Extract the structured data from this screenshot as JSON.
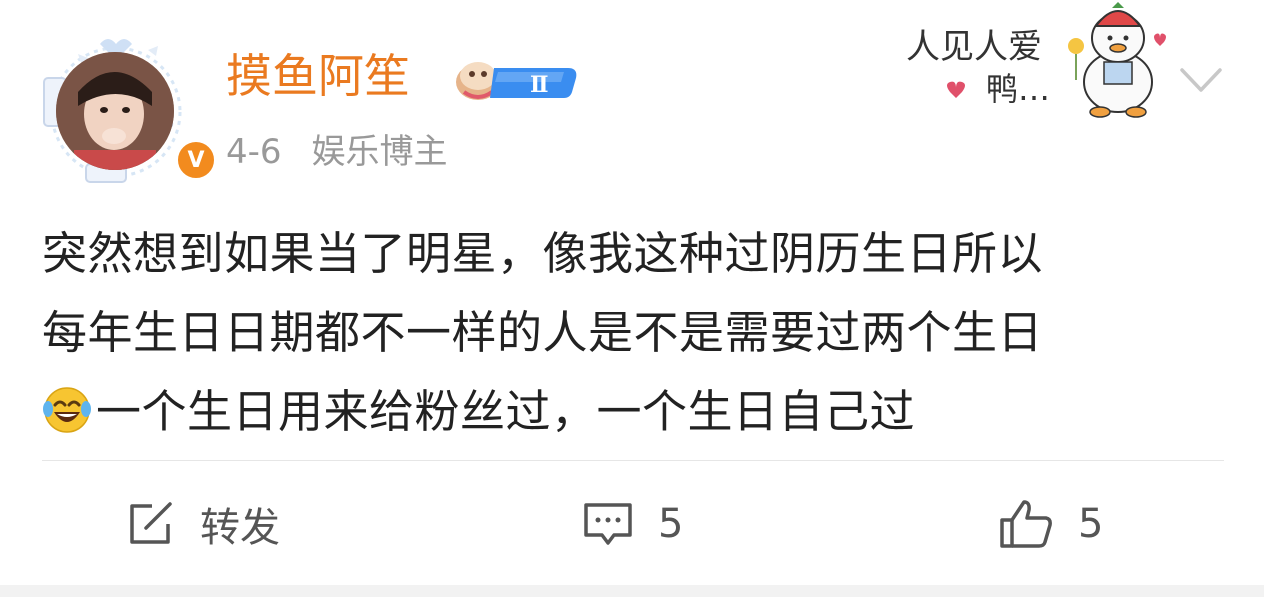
{
  "post": {
    "author": {
      "name": "摸鱼阿笙",
      "verified_badge": "V",
      "level_badge": "Ⅱ",
      "avatar": "avatar-image"
    },
    "date": "4-6",
    "category": "娱乐博主",
    "content": {
      "line1": "突然想到如果当了明星，像我这种过阴历生日所以",
      "line2": "每年生日日期都不一样的人是不是需要过两个生日",
      "line3": "一个生日用来给粉丝过，一个生日自己过",
      "emoji": "laughing-crying-emoji"
    },
    "sticker": {
      "text1": "人见人爱",
      "text2": "鸭…"
    },
    "actions": {
      "repost_label": "转发",
      "comment_count": "5",
      "like_count": "5"
    }
  },
  "colors": {
    "username": "#ea7a20",
    "meta": "#999999",
    "text": "#222222",
    "action": "#555555",
    "vbadge": "#f28b1e"
  }
}
